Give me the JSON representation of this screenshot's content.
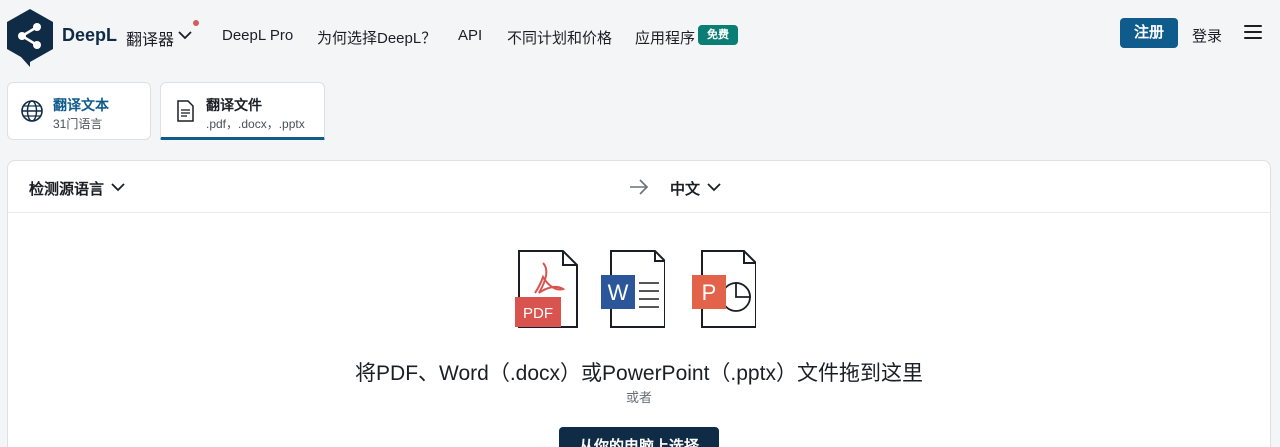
{
  "header": {
    "brand": "DeepL",
    "product": "翻译器",
    "nav": [
      "DeepL Pro",
      "为何选择DeepL？",
      "API",
      "不同计划和价格",
      "应用程序"
    ],
    "free_badge": "免费",
    "register": "注册",
    "login": "登录"
  },
  "tabs": [
    {
      "title": "翻译文本",
      "subtitle": "31门语言"
    },
    {
      "title": "翻译文件",
      "subtitle": ".pdf，.docx，.pptx"
    }
  ],
  "translator": {
    "source_lang": "检测源语言",
    "target_lang": "中文",
    "drop_text": "将PDF、Word（.docx）或PowerPoint（.pptx）文件拖到这里",
    "or": "或者",
    "select_button": "从你的电脑上选择",
    "file_types": [
      "PDF",
      "W",
      "P"
    ]
  },
  "colors": {
    "accent": "#0f5b8c",
    "dark": "#0f2b46",
    "free_badge": "#0a7e74",
    "pdf": "#d9534f",
    "word": "#2b579a",
    "ppt": "#e3634a"
  }
}
